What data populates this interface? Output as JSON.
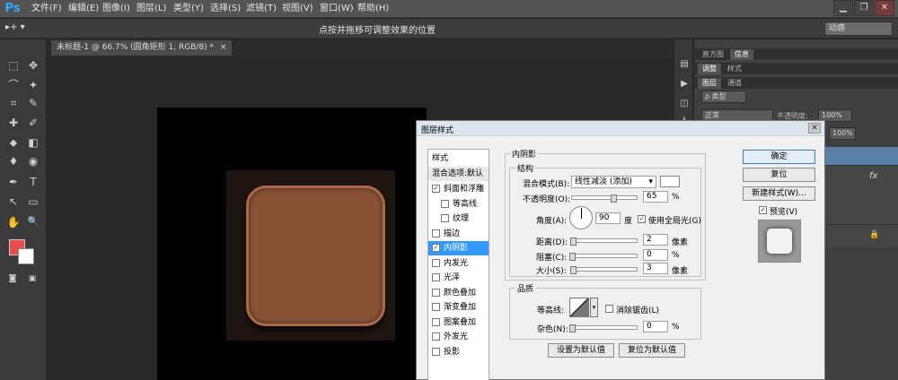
{
  "app": {
    "logo": "Ps"
  },
  "menu": [
    "文件(F)",
    "编辑(E)",
    "图像(I)",
    "图层(L)",
    "类型(Y)",
    "选择(S)",
    "滤镜(T)",
    "视图(V)",
    "窗口(W)",
    "帮助(H)"
  ],
  "window_controls": {
    "minimize": "▁",
    "restore": "❐",
    "close": "✕"
  },
  "options_bar": {
    "tool_preset": "▸+ ▾",
    "hint": "点按并拖移可调整效果的位置",
    "workspace": "动感"
  },
  "document_tab": {
    "title": "未标题-1 @ 66.7% (圆角矩形 1, RGB/8) *",
    "close": "×"
  },
  "tools": [
    "⬚",
    "✥",
    "⌒",
    "✦",
    "⌗",
    "✎",
    "✚",
    "✐",
    "⬥",
    "◧",
    "♦",
    "◉",
    "✒",
    "T",
    "↖",
    "▭",
    "✋",
    "🔍"
  ],
  "colors": {
    "foreground": "#e84d4d",
    "background": "#ffffff",
    "icon_fill": "#8a5235"
  },
  "right_panels": {
    "tab_row1": [
      "直方图",
      "信息"
    ],
    "tab_row2": [
      "调整",
      "样式"
    ],
    "tab_row3": [
      "图层",
      "通道"
    ],
    "filter_kind": "ρ 类型",
    "blend_mode": "正常",
    "opacity_label": "不透明度:",
    "opacity_value": "100%",
    "fill_value": "100%",
    "fx": "fx"
  },
  "dialog": {
    "title": "图层样式",
    "close": "✕",
    "styles_header": "样式",
    "blend_default": "混合选项:默认",
    "items": [
      {
        "label": "斜面和浮雕",
        "checked": true,
        "indent": false
      },
      {
        "label": "等高线",
        "checked": false,
        "indent": true
      },
      {
        "label": "纹理",
        "checked": false,
        "indent": true
      },
      {
        "label": "描边",
        "checked": false,
        "indent": false
      },
      {
        "label": "内阴影",
        "checked": true,
        "indent": false,
        "selected": true
      },
      {
        "label": "内发光",
        "checked": false,
        "indent": false
      },
      {
        "label": "光泽",
        "checked": false,
        "indent": false
      },
      {
        "label": "颜色叠加",
        "checked": false,
        "indent": false
      },
      {
        "label": "渐变叠加",
        "checked": false,
        "indent": false
      },
      {
        "label": "图案叠加",
        "checked": false,
        "indent": false
      },
      {
        "label": "外发光",
        "checked": false,
        "indent": false
      },
      {
        "label": "投影",
        "checked": false,
        "indent": false
      }
    ],
    "section_title": "内阴影",
    "structure_title": "结构",
    "blend_mode_label": "混合模式(B):",
    "blend_mode_value": "线性减淡 (添加)",
    "opacity_label": "不透明度(O):",
    "opacity_value": "65",
    "percent": "%",
    "angle_label": "角度(A):",
    "angle_value": "90",
    "degree": "度",
    "global_light_label": "使用全局光(G)",
    "distance_label": "距离(D):",
    "distance_value": "2",
    "choke_label": "阻塞(C):",
    "choke_value": "0",
    "size_label": "大小(S):",
    "size_value": "3",
    "px": "像素",
    "quality_title": "品质",
    "contour_label": "等高线:",
    "antialias_label": "消除锯齿(L)",
    "noise_label": "杂色(N):",
    "noise_value": "0",
    "set_default": "设置为默认值",
    "reset_default": "复位为默认值",
    "ok": "确定",
    "reset": "复位",
    "new_style": "新建样式(W)...",
    "preview_label": "预览(V)",
    "slider_levels": {
      "opacity": 0.65,
      "distance": 0.02,
      "choke": 0,
      "size": 0.02,
      "noise": 0
    }
  }
}
